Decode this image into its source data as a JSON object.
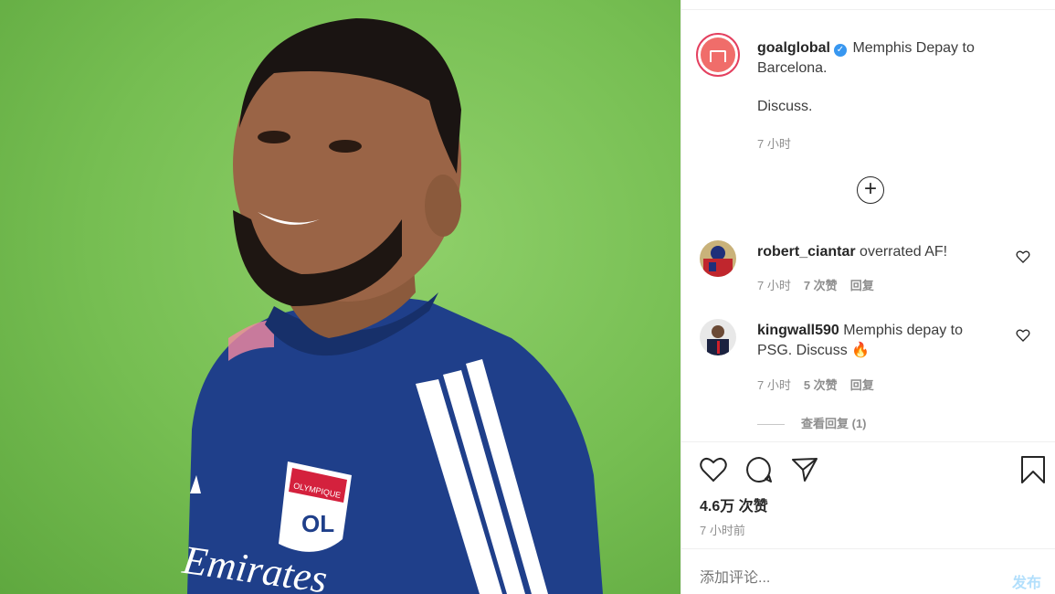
{
  "post": {
    "username": "goalglobal",
    "verified_mark": "✓",
    "caption_line1": "Memphis Depay to",
    "caption_line2": "Barcelona.",
    "caption_line3": "Discuss.",
    "time": "7 小时",
    "load_more_symbol": "+"
  },
  "comments": [
    {
      "username": "robert_ciantar",
      "text": "overrated AF!",
      "time": "7 小时",
      "likes": "7 次赞",
      "reply": "回复"
    },
    {
      "username": "kingwall590",
      "text_line1": "Memphis depay to",
      "text_line2": "PSG. Discuss",
      "emoji": "🔥",
      "time": "7 小时",
      "likes": "5 次赞",
      "reply": "回复"
    }
  ],
  "view_replies": "查看回复 (1)",
  "likes_count": "4.6万 次赞",
  "post_age": "7 小时前",
  "comment_box": {
    "placeholder": "添加评论...",
    "post_label": "发布"
  },
  "colors": {
    "accent": "#3897f0",
    "post_disabled": "#b2dffc",
    "avatar_ring": "#e4405f",
    "goal_avatar_bg": "#f06d6a",
    "jersey": "#1f3f8a",
    "grass": "#76be52"
  },
  "icons": {
    "like": "heart-icon",
    "comment": "comment-bubble-icon",
    "share": "paper-plane-icon",
    "save": "bookmark-icon",
    "comment_like": "small-heart-icon",
    "load_more": "plus-circle-icon"
  },
  "photo": {
    "jersey_text": "Emirates",
    "badge_top": "OLYMPIQUE",
    "badge_mid": "LYONNAIS",
    "badge_letter": "OL"
  }
}
